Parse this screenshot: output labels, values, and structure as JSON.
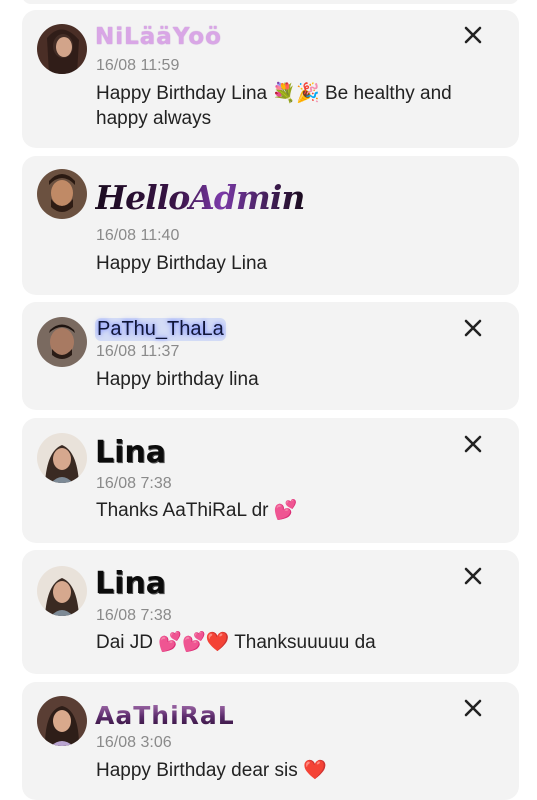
{
  "comments": [
    {
      "author": "NiLääYoö",
      "time": "16/08 11:59",
      "text": "Happy Birthday Lina 💐🎉 Be healthy and happy always",
      "deletable": true,
      "avatar_color": "#5a3a30"
    },
    {
      "author": "HelloAdmin",
      "time": "16/08 11:40",
      "text": "Happy Birthday Lina",
      "deletable": false,
      "avatar_color": "#6b4a30"
    },
    {
      "author": "PaThu_ThaLa",
      "time": "16/08 11:37",
      "text": "Happy birthday lina",
      "deletable": true,
      "avatar_color": "#5e4638"
    },
    {
      "author": "Lina",
      "time": "16/08 7:38",
      "text": "Thanks AaThiRaL dr 💕",
      "deletable": true,
      "avatar_color": "#3a2a24"
    },
    {
      "author": "Lina",
      "time": "16/08 7:38",
      "text": "Dai JD 💕💕❤️ Thanksuuuuu da",
      "deletable": true,
      "avatar_color": "#3a2a24"
    },
    {
      "author": "AaThiRaL",
      "time": "16/08 3:06",
      "text": "Happy Birthday dear sis ❤️",
      "deletable": true,
      "avatar_color": "#4a3028"
    }
  ],
  "icons": {
    "close": "close-icon"
  },
  "colors": {
    "card_bg": "#f3f3f3",
    "timestamp": "#8a8a8a",
    "message_text": "#222222"
  }
}
